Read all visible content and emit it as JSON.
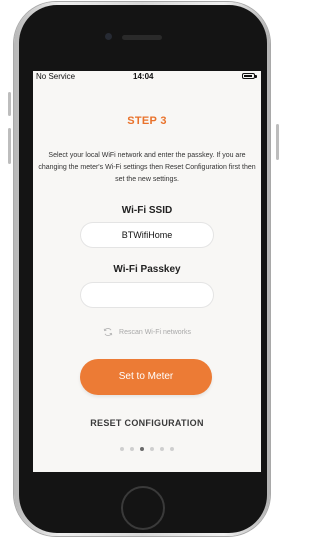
{
  "status_bar": {
    "carrier": "No Service",
    "time": "14:04"
  },
  "step": {
    "title": "STEP 3",
    "instructions": "Select your local WiFi network and enter the passkey. If you are changing the meter's Wi-Fi settings then Reset Configuration first then set the new settings."
  },
  "wifi": {
    "ssid_label": "Wi-Fi SSID",
    "ssid_value": "BTWifiHome",
    "passkey_label": "Wi-Fi Passkey",
    "passkey_value": "",
    "rescan_label": "Rescan Wi-Fi networks"
  },
  "actions": {
    "set_button": "Set to Meter",
    "reset_link": "RESET CONFIGURATION"
  },
  "pagination": {
    "total": 6,
    "active_index": 2
  },
  "colors": {
    "accent": "#ec7b35",
    "screen_background": "#f8f7f5",
    "text_primary": "#222222",
    "text_muted": "#a9a9a9"
  }
}
